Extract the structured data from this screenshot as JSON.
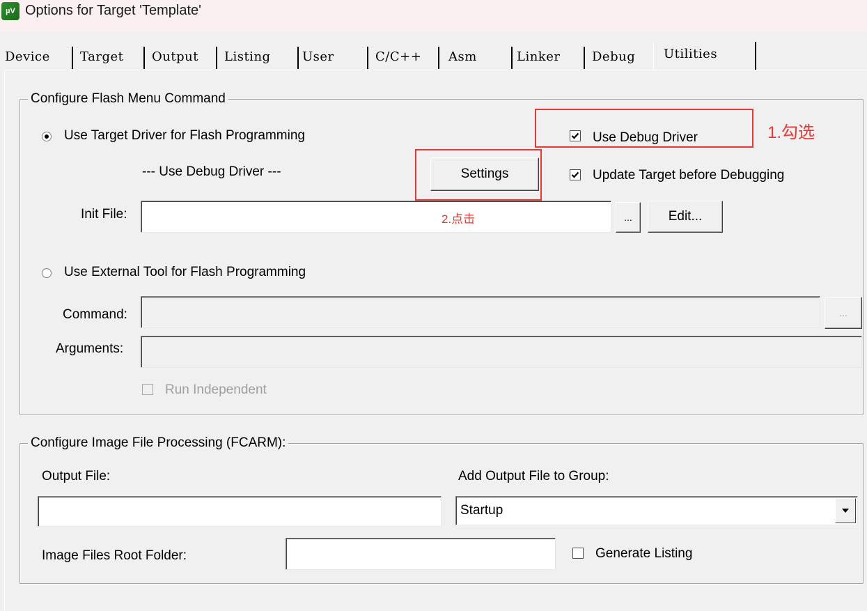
{
  "window": {
    "title": "Options for Target 'Template'",
    "icon": "keil-uvision-icon"
  },
  "tabs": [
    {
      "label": "Device"
    },
    {
      "label": "Target"
    },
    {
      "label": "Output"
    },
    {
      "label": "Listing"
    },
    {
      "label": "User"
    },
    {
      "label": "C/C++"
    },
    {
      "label": "Asm"
    },
    {
      "label": "Linker"
    },
    {
      "label": "Debug"
    },
    {
      "label": "Utilities",
      "active": true
    }
  ],
  "flash": {
    "group_title": "Configure Flash Menu Command",
    "use_target_driver_label": "Use Target Driver for Flash Programming",
    "use_target_driver_selected": true,
    "driver_name": "--- Use Debug Driver ---",
    "settings_button": "Settings",
    "use_debug_driver_label": "Use Debug Driver",
    "use_debug_driver_checked": true,
    "update_target_label": "Update Target before Debugging",
    "update_target_checked": true,
    "init_file_label": "Init File:",
    "init_file_value": "",
    "browse_button": "...",
    "edit_button": "Edit...",
    "use_external_tool_label": "Use External Tool for Flash Programming",
    "use_external_tool_selected": false,
    "command_label": "Command:",
    "command_value": "",
    "command_browse": "...",
    "arguments_label": "Arguments:",
    "arguments_value": "",
    "run_independent_label": "Run Independent",
    "run_independent_checked": false
  },
  "image": {
    "group_title": "Configure Image File Processing (FCARM):",
    "output_file_label": "Output File:",
    "output_file_value": "",
    "add_to_group_label": "Add Output File  to Group:",
    "group_selected": "Startup",
    "root_folder_label": "Image Files Root Folder:",
    "root_folder_value": "",
    "generate_listing_label": "Generate Listing",
    "generate_listing_checked": false
  },
  "annotations": {
    "step1": "1.勾选",
    "step2": "2.点击",
    "color": "#e53935"
  }
}
